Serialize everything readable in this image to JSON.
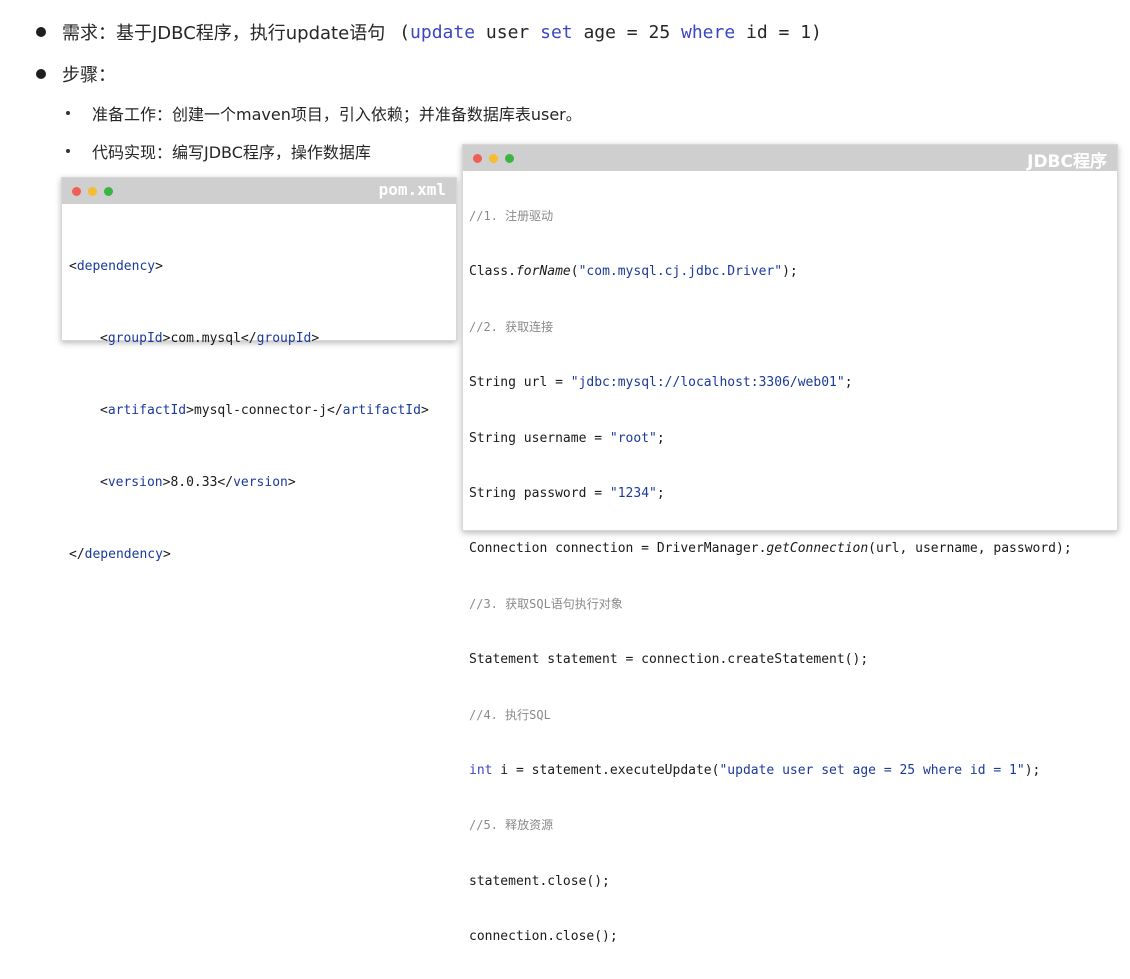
{
  "bullets": {
    "b1_label": "需求：基于JDBC程序，执行update语句",
    "b1_sql": {
      "open": "(",
      "kw1": "update",
      "p1": " user ",
      "kw2": "set",
      "p2": " age = 25 ",
      "kw3": "where",
      "p3": " id = 1",
      "close": ")"
    },
    "b2_label": "步骤：",
    "sub1": "准备工作：创建一个maven项目，引入依赖；并准备数据库表user。",
    "sub2": "代码实现：编写JDBC程序，操作数据库"
  },
  "pom": {
    "title": "pom.xml",
    "l1_tag": "dependency",
    "l2_tag": "groupId",
    "l2_val": "com.mysql",
    "l3_tag": "artifactId",
    "l3_val": "mysql-connector-j",
    "l4_tag": "version",
    "l4_val": "8.0.33",
    "l5_tag": "dependency"
  },
  "jdbc": {
    "title": "JDBC程序",
    "c1": "//1. 注册驱动",
    "l1a": "Class.",
    "l1b": "forName",
    "l1c": "(",
    "l1d": "\"com.mysql.cj.jdbc.Driver\"",
    "l1e": ");",
    "c2": "//2. 获取连接",
    "l2a": "String url = ",
    "l2b": "\"jdbc:mysql://localhost:3306/web01\"",
    "l2c": ";",
    "l3a": "String username = ",
    "l3b": "\"root\"",
    "l3c": ";",
    "l4a": "String password = ",
    "l4b": "\"1234\"",
    "l4c": ";",
    "l5a": "Connection connection = DriverManager.",
    "l5b": "getConnection",
    "l5c": "(url, username, password);",
    "c3": "//3. 获取SQL语句执行对象",
    "l6": "Statement statement = connection.createStatement();",
    "c4": "//4. 执行SQL",
    "l7a": "int",
    "l7b": " i = statement.executeUpdate(",
    "l7c": "\"update user set age = 25 where id = 1\"",
    "l7d": ");",
    "c5": "//5. 释放资源",
    "l8": "statement.close();",
    "l9": "connection.close();"
  },
  "colors": {
    "red": "#ee5f55",
    "yellow": "#f5bd2f",
    "green": "#3bb443",
    "bar": "#cfcfcf"
  }
}
